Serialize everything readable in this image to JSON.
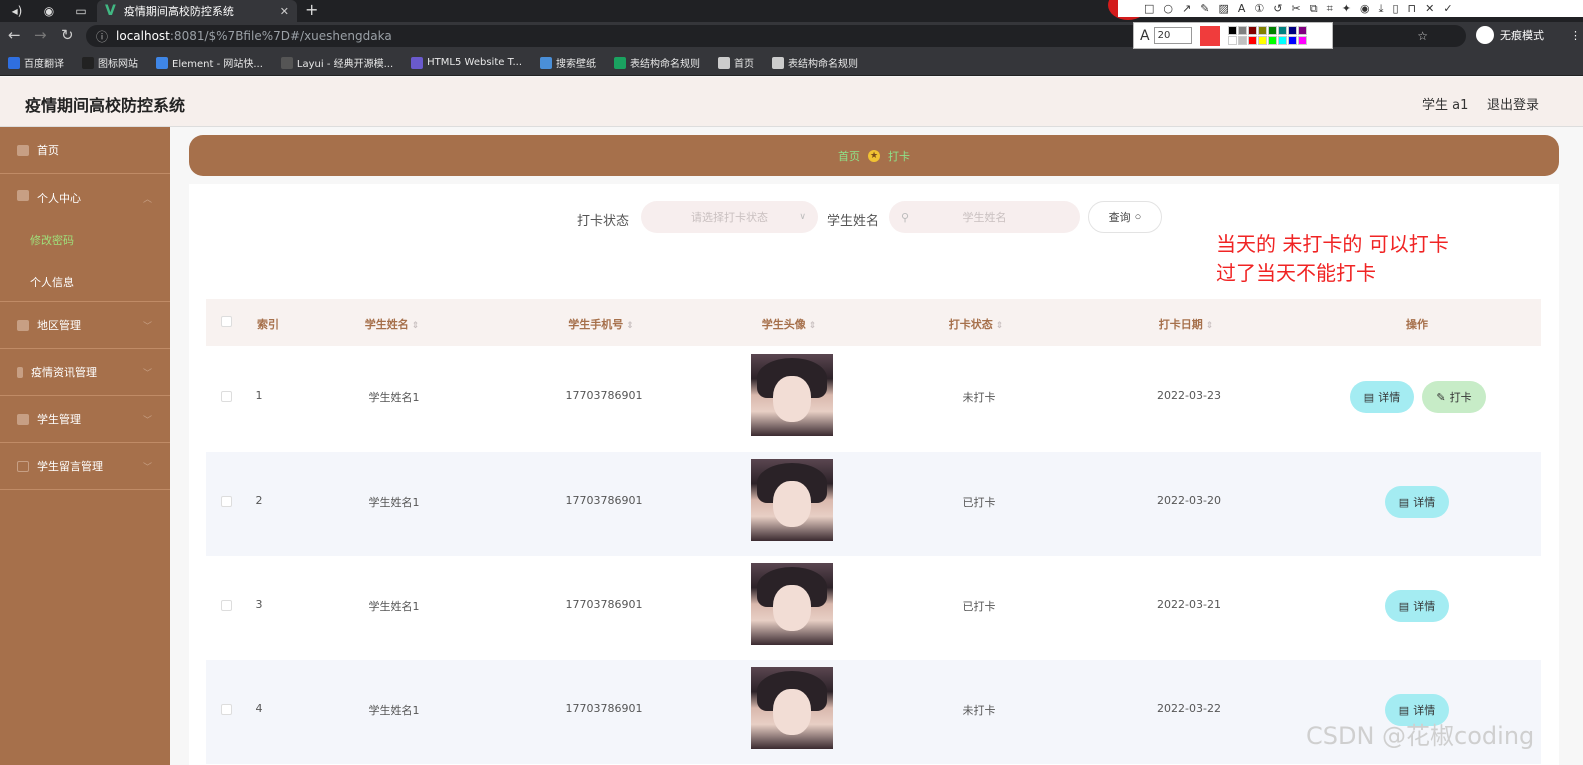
{
  "browser": {
    "tab_title": "疫情期间高校防控系统",
    "url_host": "localhost",
    "url_path": ":8081/$%7Bfile%7D#/xueshengdaka",
    "incognito_label": "无痕模式",
    "bookmarks": [
      {
        "label": "百度翻译",
        "color": "#2f6fe0"
      },
      {
        "label": "图标网站",
        "color": "#222222"
      },
      {
        "label": "Element - 网站快...",
        "color": "#3f86e6"
      },
      {
        "label": "Layui - 经典开源模...",
        "color": "#555555"
      },
      {
        "label": "HTML5 Website T...",
        "color": "#6a5acd"
      },
      {
        "label": "搜索壁纸",
        "color": "#4a8fd8"
      },
      {
        "label": "表结构命名规则",
        "color": "#1aa260"
      },
      {
        "label": "首页",
        "color": "#cccccc"
      },
      {
        "label": "表结构命名规则",
        "color": "#cccccc"
      }
    ]
  },
  "annotation_tool": {
    "font_size": "20",
    "current_color": "#f03c3c",
    "palette": [
      "#000000",
      "#808080",
      "#800000",
      "#808000",
      "#008000",
      "#008080",
      "#000080",
      "#800080",
      "#ffffff",
      "#c0c0c0",
      "#ff0000",
      "#ffff00",
      "#00ff00",
      "#00ffff",
      "#0000ff",
      "#ff00ff"
    ]
  },
  "header": {
    "title": "疫情期间高校防控系统",
    "user": "学生 a1",
    "logout": "退出登录"
  },
  "sidebar": {
    "items": [
      {
        "label": "首页"
      },
      {
        "label": "个人中心"
      },
      {
        "label": "地区管理"
      },
      {
        "label": "疫情资讯管理"
      },
      {
        "label": "学生管理"
      },
      {
        "label": "学生留言管理"
      }
    ],
    "sub_items": [
      {
        "label": "修改密码",
        "active": true
      },
      {
        "label": "个人信息",
        "active": false
      }
    ]
  },
  "breadcrumb": {
    "home": "首页",
    "current": "打卡"
  },
  "filter": {
    "status_label": "打卡状态",
    "status_placeholder": "请选择打卡状态",
    "name_label": "学生姓名",
    "name_placeholder": "学生姓名",
    "query_label": "查询"
  },
  "annotation_text": {
    "line1": "当天的 未打卡的 可以打卡",
    "line2": "过了当天不能打卡"
  },
  "table": {
    "columns": [
      "索引",
      "学生姓名",
      "学生手机号",
      "学生头像",
      "打卡状态",
      "打卡日期",
      "操作"
    ],
    "rows": [
      {
        "index": "1",
        "name": "学生姓名1",
        "phone": "17703786901",
        "status": "未打卡",
        "date": "2022-03-23",
        "can_punch": true
      },
      {
        "index": "2",
        "name": "学生姓名1",
        "phone": "17703786901",
        "status": "已打卡",
        "date": "2022-03-20",
        "can_punch": false
      },
      {
        "index": "3",
        "name": "学生姓名1",
        "phone": "17703786901",
        "status": "已打卡",
        "date": "2022-03-21",
        "can_punch": false
      },
      {
        "index": "4",
        "name": "学生姓名1",
        "phone": "17703786901",
        "status": "未打卡",
        "date": "2022-03-22",
        "can_punch": false
      }
    ],
    "detail_label": "详情",
    "punch_label": "打卡"
  },
  "watermark": "CSDN @花椒coding"
}
